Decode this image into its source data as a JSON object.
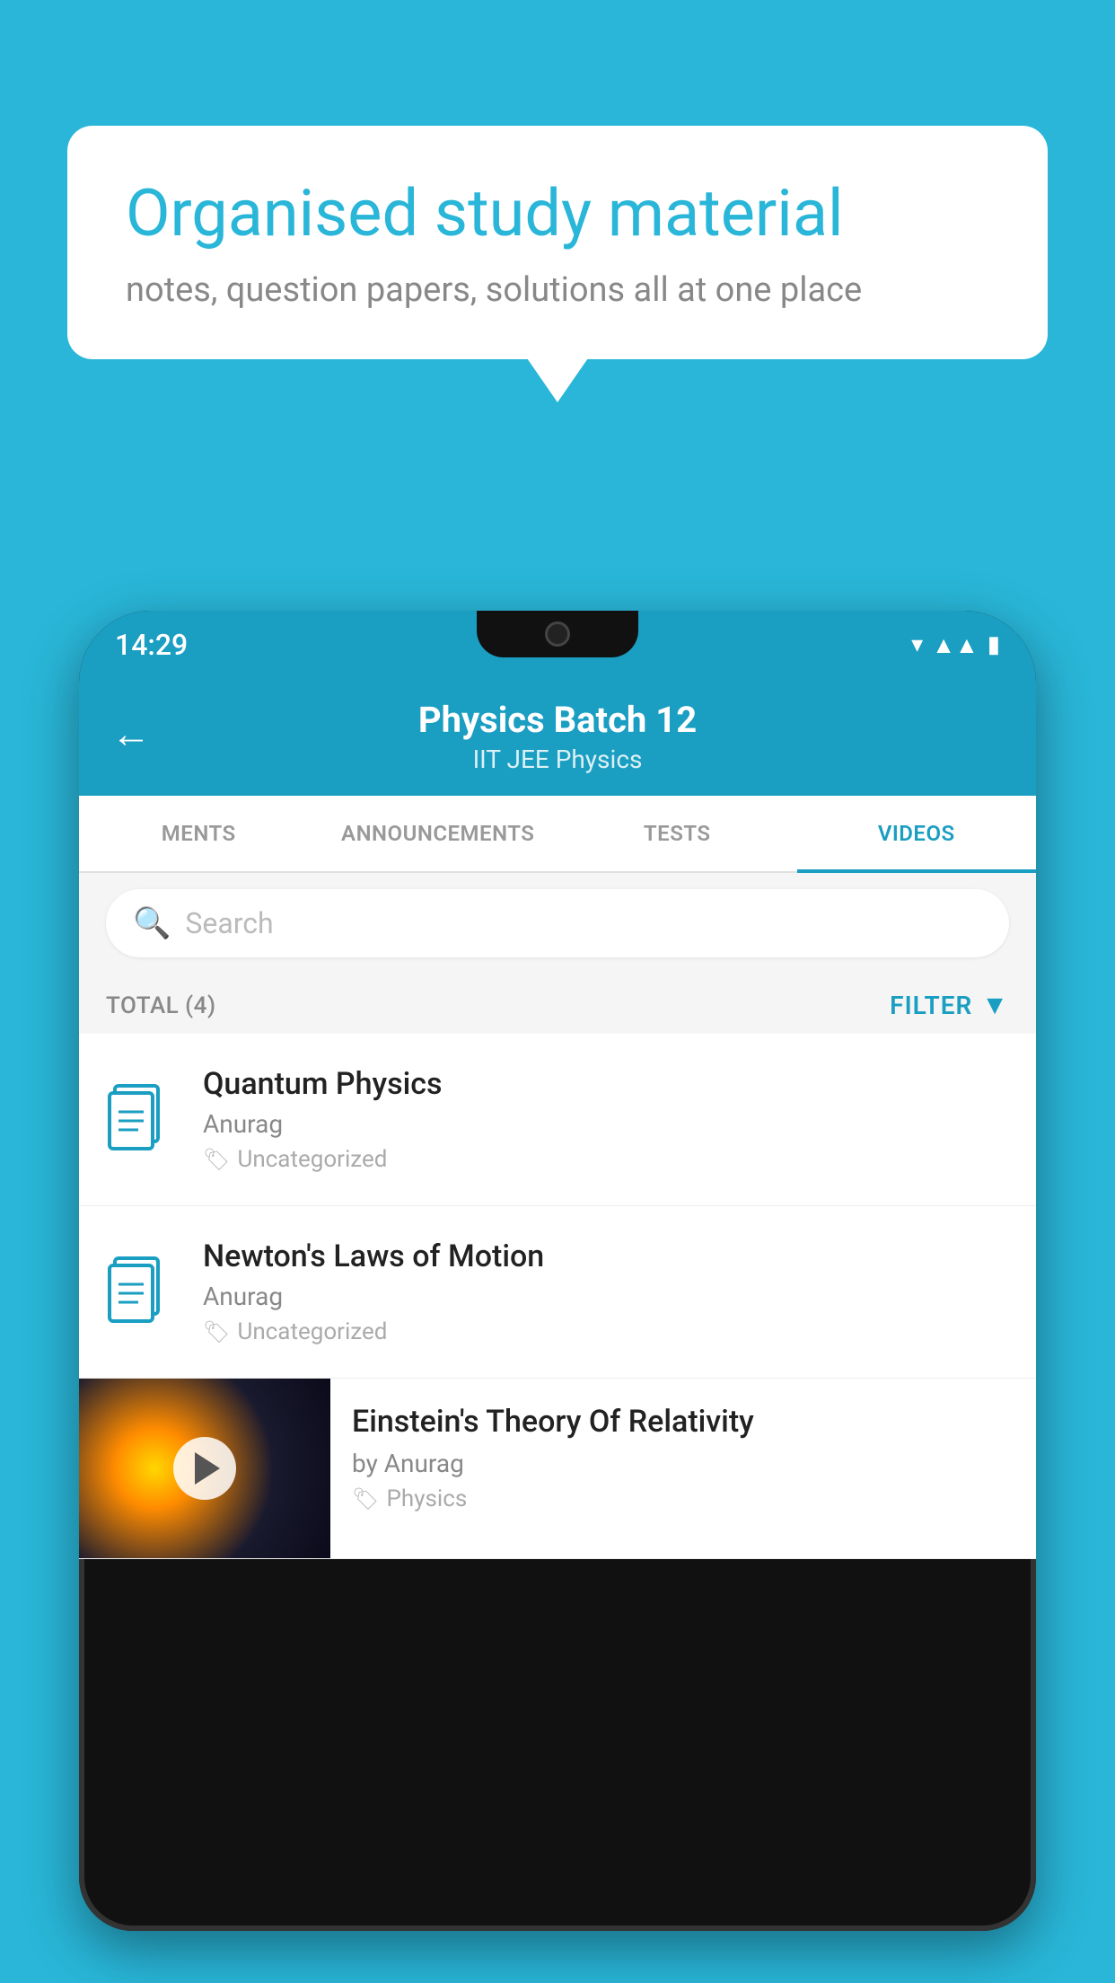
{
  "background_color": "#29b6d8",
  "bubble": {
    "title": "Organised study material",
    "subtitle": "notes, question papers, solutions all at one place"
  },
  "status_bar": {
    "time": "14:29"
  },
  "header": {
    "title": "Physics Batch 12",
    "subtitle": "IIT JEE   Physics",
    "back_label": "←"
  },
  "tabs": [
    {
      "label": "MENTS",
      "active": false
    },
    {
      "label": "ANNOUNCEMENTS",
      "active": false
    },
    {
      "label": "TESTS",
      "active": false
    },
    {
      "label": "VIDEOS",
      "active": true
    }
  ],
  "search": {
    "placeholder": "Search"
  },
  "filter": {
    "total_label": "TOTAL (4)",
    "filter_label": "FILTER"
  },
  "videos": [
    {
      "title": "Quantum Physics",
      "author": "Anurag",
      "tag": "Uncategorized",
      "has_thumbnail": false
    },
    {
      "title": "Newton's Laws of Motion",
      "author": "Anurag",
      "tag": "Uncategorized",
      "has_thumbnail": false
    },
    {
      "title": "Einstein's Theory Of Relativity",
      "author": "by Anurag",
      "tag": "Physics",
      "has_thumbnail": true
    }
  ]
}
